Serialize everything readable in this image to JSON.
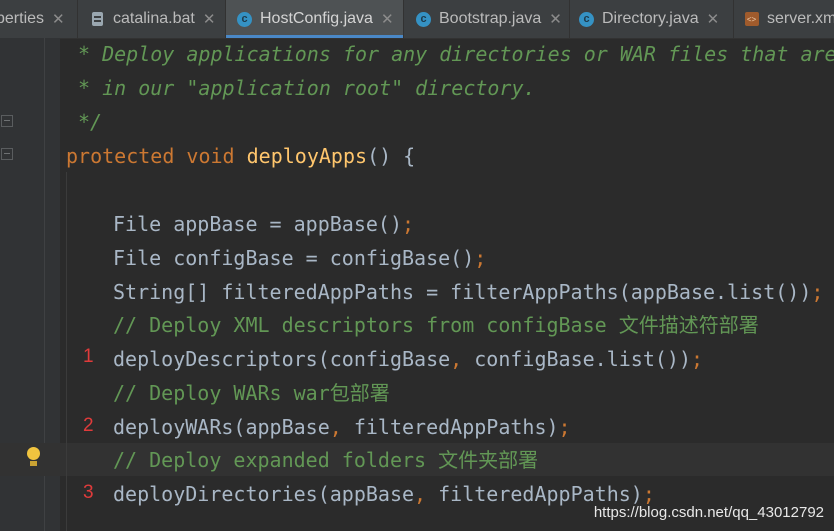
{
  "tabs": [
    {
      "label": "perties",
      "icon": "properties-file-icon",
      "active": false
    },
    {
      "label": "catalina.bat",
      "icon": "file-icon",
      "active": false
    },
    {
      "label": "HostConfig.java",
      "icon": "class-icon",
      "active": true
    },
    {
      "label": "Bootstrap.java",
      "icon": "class-icon",
      "active": false
    },
    {
      "label": "Directory.java",
      "icon": "class-icon",
      "active": false
    },
    {
      "label": "server.xm",
      "icon": "xml-file-icon",
      "active": false
    }
  ],
  "tab_close_glyph": "✕",
  "code": {
    "doc1": "* Deploy applications for any directories or WAR files that are",
    "doc2": "* in our \"application root\" directory.",
    "doc3": "*/",
    "sig_kw1": "protected",
    "sig_kw2": "void",
    "sig_fn": "deployApps",
    "sig_rest": "() {",
    "l1": "File appBase = appBase()",
    "l2": "File configBase = configBase()",
    "l3": "String[] filteredAppPaths = filterAppPaths(appBase.list())",
    "c1": "// Deploy XML descriptors from configBase ",
    "c1_cn": "文件描述符部署",
    "l4a": "deployDescriptors(configBase",
    "l4b": " configBase.list())",
    "c2": "// Deploy WARs war",
    "c2_cn": "包部署",
    "l5a": "deployWARs(appBase",
    "l5b": " filteredAppPaths)",
    "c3": "// Deploy expanded folders ",
    "c3_cn": "文件夹部署",
    "l6a": "deployDirectories(appBase",
    "l6b": " filteredAppPaths)",
    "semi": ";",
    "comma": ","
  },
  "annotations": [
    "1",
    "2",
    "3"
  ],
  "watermark": "https://blog.csdn.net/qq_43012792",
  "colors": {
    "background": "#2b2b2b",
    "keyword": "#cc7832",
    "function": "#ffc66d",
    "doc_comment": "#629755",
    "annotation_number": "#e03b3b"
  }
}
